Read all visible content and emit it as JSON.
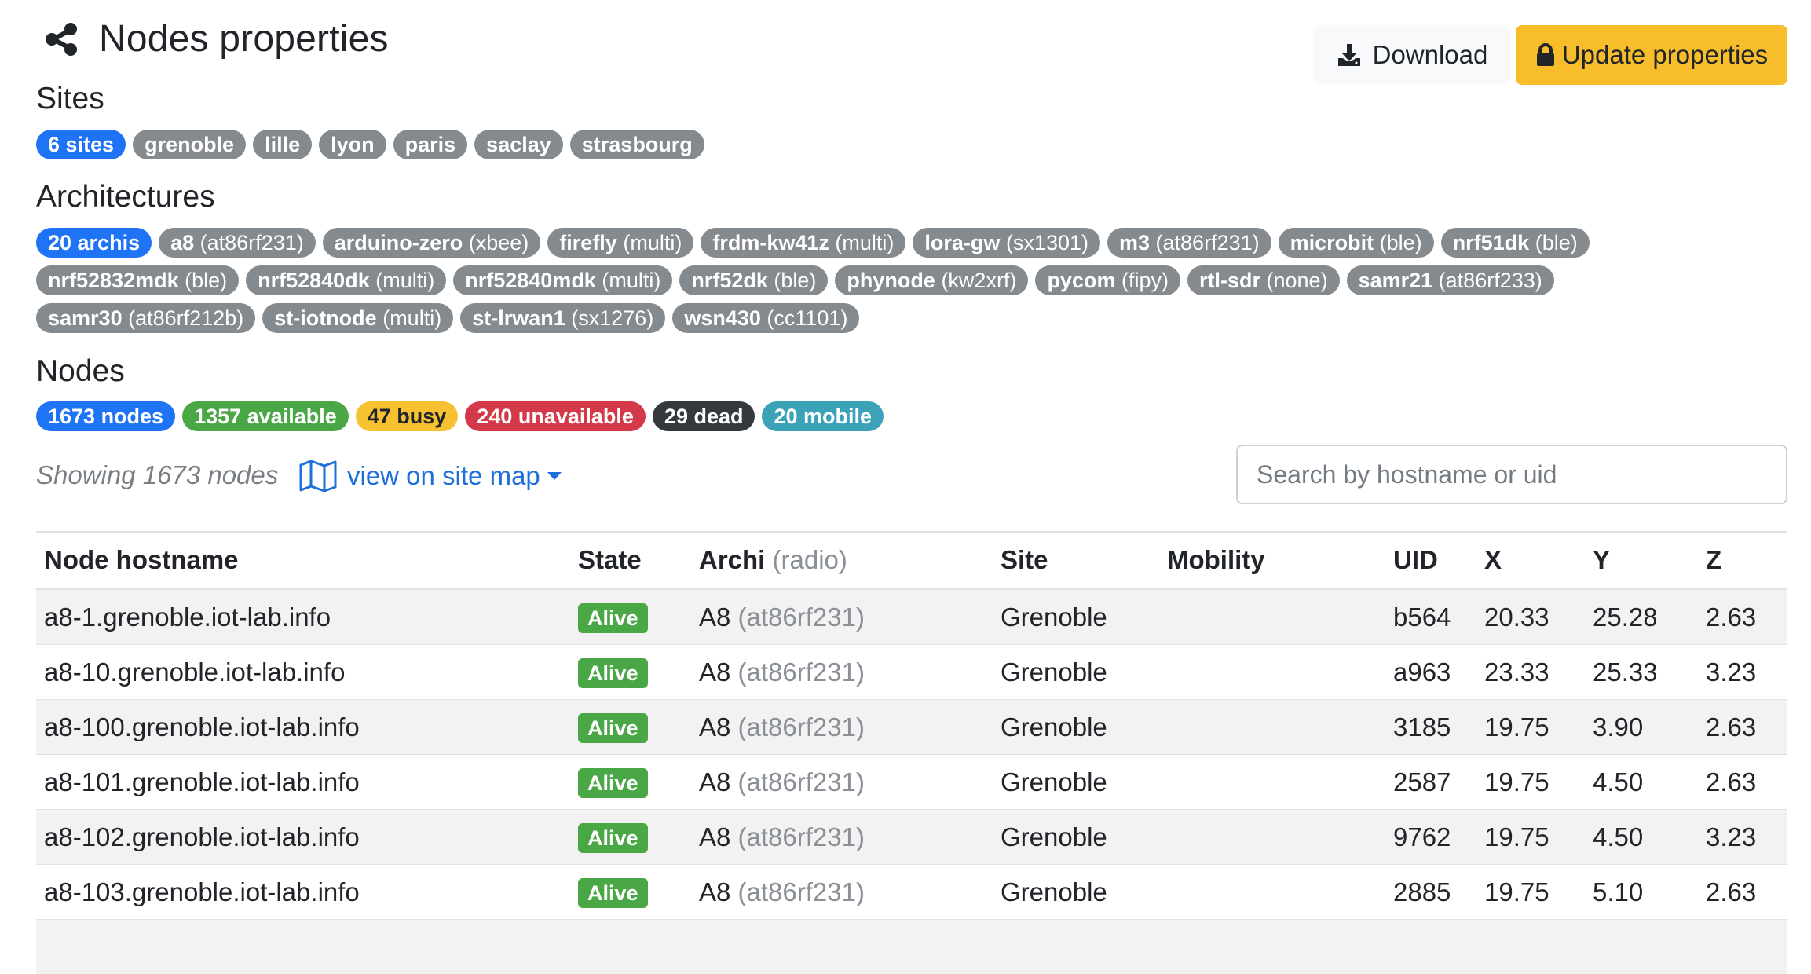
{
  "header": {
    "title": "Nodes properties",
    "download_label": "Download",
    "update_label": "Update properties"
  },
  "sites": {
    "heading": "Sites",
    "count_badge": "6 sites",
    "items": [
      "grenoble",
      "lille",
      "lyon",
      "paris",
      "saclay",
      "strasbourg"
    ]
  },
  "architectures": {
    "heading": "Architectures",
    "count_badge": "20 archis",
    "items": [
      {
        "name": "a8",
        "radio": "(at86rf231)"
      },
      {
        "name": "arduino-zero",
        "radio": "(xbee)"
      },
      {
        "name": "firefly",
        "radio": "(multi)"
      },
      {
        "name": "frdm-kw41z",
        "radio": "(multi)"
      },
      {
        "name": "lora-gw",
        "radio": "(sx1301)"
      },
      {
        "name": "m3",
        "radio": "(at86rf231)"
      },
      {
        "name": "microbit",
        "radio": "(ble)"
      },
      {
        "name": "nrf51dk",
        "radio": "(ble)"
      },
      {
        "name": "nrf52832mdk",
        "radio": "(ble)"
      },
      {
        "name": "nrf52840dk",
        "radio": "(multi)"
      },
      {
        "name": "nrf52840mdk",
        "radio": "(multi)"
      },
      {
        "name": "nrf52dk",
        "radio": "(ble)"
      },
      {
        "name": "phynode",
        "radio": "(kw2xrf)"
      },
      {
        "name": "pycom",
        "radio": "(fipy)"
      },
      {
        "name": "rtl-sdr",
        "radio": "(none)"
      },
      {
        "name": "samr21",
        "radio": "(at86rf233)"
      },
      {
        "name": "samr30",
        "radio": "(at86rf212b)"
      },
      {
        "name": "st-iotnode",
        "radio": "(multi)"
      },
      {
        "name": "st-lrwan1",
        "radio": "(sx1276)"
      },
      {
        "name": "wsn430",
        "radio": "(cc1101)"
      }
    ]
  },
  "nodes": {
    "heading": "Nodes",
    "total": "1673 nodes",
    "available": "1357 available",
    "busy": "47 busy",
    "unavailable": "240 unavailable",
    "dead": "29 dead",
    "mobile": "20 mobile"
  },
  "toolbar": {
    "showing": "Showing 1673 nodes",
    "map_link": "view on site map",
    "search_placeholder": "Search by hostname or uid"
  },
  "table": {
    "columns": {
      "hostname": "Node hostname",
      "state": "State",
      "archi": "Archi",
      "archi_sub": "(radio)",
      "site": "Site",
      "mobility": "Mobility",
      "uid": "UID",
      "x": "X",
      "y": "Y",
      "z": "Z"
    },
    "rows": [
      {
        "hostname": "a8-1.grenoble.iot-lab.info",
        "state": "Alive",
        "archi": "A8",
        "radio": "(at86rf231)",
        "site": "Grenoble",
        "mobility": "",
        "uid": "b564",
        "x": "20.33",
        "y": "25.28",
        "z": "2.63"
      },
      {
        "hostname": "a8-10.grenoble.iot-lab.info",
        "state": "Alive",
        "archi": "A8",
        "radio": "(at86rf231)",
        "site": "Grenoble",
        "mobility": "",
        "uid": "a963",
        "x": "23.33",
        "y": "25.33",
        "z": "3.23"
      },
      {
        "hostname": "a8-100.grenoble.iot-lab.info",
        "state": "Alive",
        "archi": "A8",
        "radio": "(at86rf231)",
        "site": "Grenoble",
        "mobility": "",
        "uid": "3185",
        "x": "19.75",
        "y": "3.90",
        "z": "2.63"
      },
      {
        "hostname": "a8-101.grenoble.iot-lab.info",
        "state": "Alive",
        "archi": "A8",
        "radio": "(at86rf231)",
        "site": "Grenoble",
        "mobility": "",
        "uid": "2587",
        "x": "19.75",
        "y": "4.50",
        "z": "2.63"
      },
      {
        "hostname": "a8-102.grenoble.iot-lab.info",
        "state": "Alive",
        "archi": "A8",
        "radio": "(at86rf231)",
        "site": "Grenoble",
        "mobility": "",
        "uid": "9762",
        "x": "19.75",
        "y": "4.50",
        "z": "3.23"
      },
      {
        "hostname": "a8-103.grenoble.iot-lab.info",
        "state": "Alive",
        "archi": "A8",
        "radio": "(at86rf231)",
        "site": "Grenoble",
        "mobility": "",
        "uid": "2885",
        "x": "19.75",
        "y": "5.10",
        "z": "2.63"
      }
    ]
  },
  "colors": {
    "primary": "#1f74f6",
    "success": "#4aa745",
    "warning": "#f6c232",
    "danger": "#d4394a",
    "dark": "#33393f",
    "info": "#3ba2b8",
    "secondary": "#858a8f"
  },
  "icons": {
    "title": "share-icon",
    "download": "download-icon",
    "update": "lock-icon",
    "map": "map-icon",
    "dropdown": "caret-down-icon"
  }
}
